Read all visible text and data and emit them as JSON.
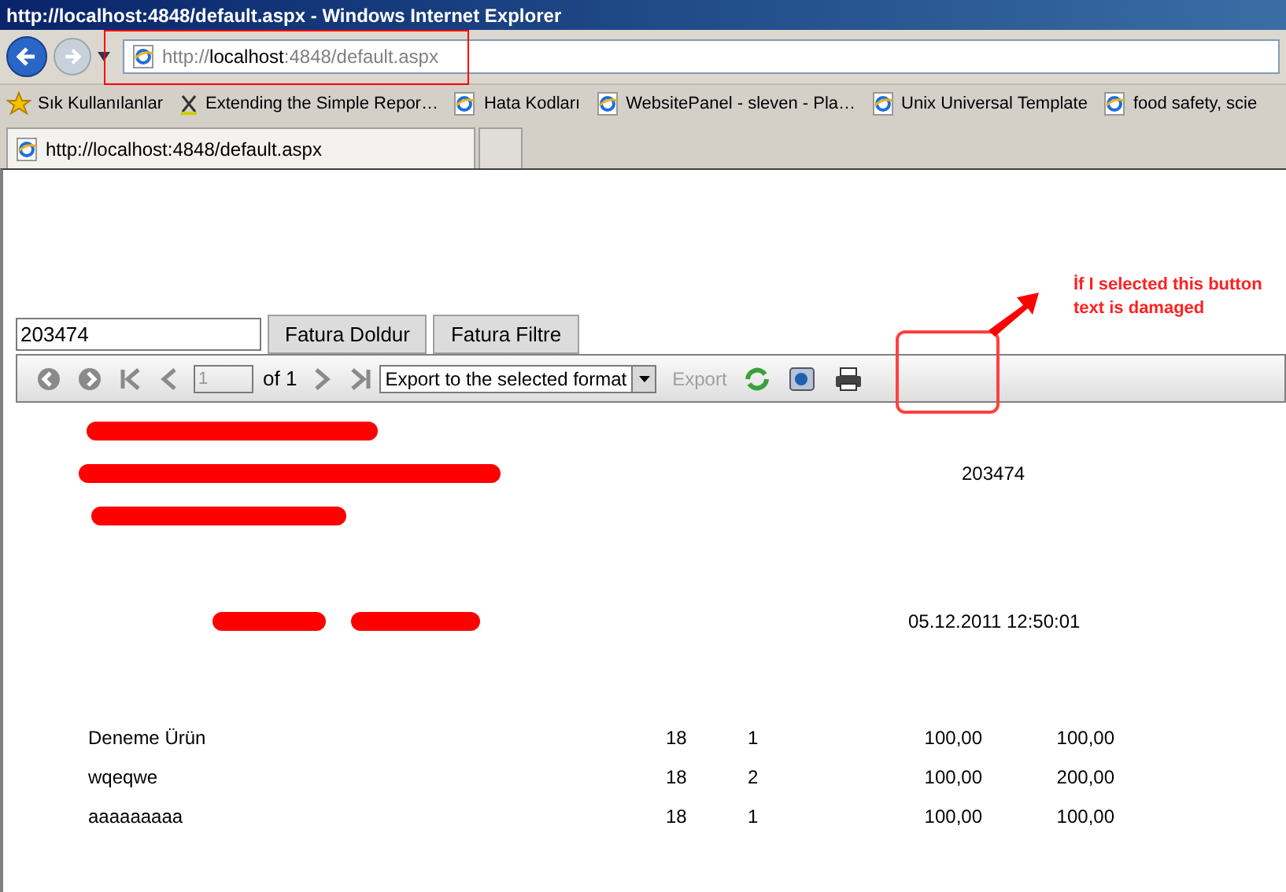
{
  "window": {
    "title": "http://localhost:4848/default.aspx - Windows Internet Explorer"
  },
  "address_bar": {
    "url_parts": [
      {
        "text": "http://",
        "kind": "dim"
      },
      {
        "text": "localhost",
        "kind": "host"
      },
      {
        "text": ":4848/default.aspx",
        "kind": "dim"
      }
    ]
  },
  "favorites_bar": {
    "label": "Sık Kullanılanlar",
    "links": [
      {
        "label": "Extending the Simple Repor…",
        "kind": "feed"
      },
      {
        "label": "Hata Kodları",
        "kind": "page"
      },
      {
        "label": "WebsitePanel - sleven - Pla…",
        "kind": "page"
      },
      {
        "label": "Unix Universal Template",
        "kind": "page"
      },
      {
        "label": "food safety, scie",
        "kind": "page"
      }
    ]
  },
  "tabs": [
    {
      "label": "http://localhost:4848/default.aspx",
      "selected": true
    }
  ],
  "form": {
    "invoice_number": "203474",
    "buttons": [
      "Fatura Doldur",
      "Fatura Filtre"
    ]
  },
  "report_toolbar": {
    "page": "1",
    "page_count": "of 1",
    "export_format": "Export to the selected format",
    "export_button": {
      "label": "Export",
      "disabled": true
    }
  },
  "report": {
    "invoice_number": "203474",
    "date": "05.12.2011 12:50:01",
    "rows": [
      {
        "item": "Deneme Ürün",
        "column_2": "18",
        "column_3": "1",
        "column_4": "100,00",
        "column_5": "100,00"
      },
      {
        "item": "wqeqwe",
        "column_2": "18",
        "column_3": "2",
        "column_4": "100,00",
        "column_5": "200,00"
      },
      {
        "item": "aaaaaaaaa",
        "column_2": "18",
        "column_3": "1",
        "column_4": "100,00",
        "column_5": "100,00"
      }
    ]
  },
  "annotation": {
    "text": "İf I selected this button text is damaged"
  }
}
